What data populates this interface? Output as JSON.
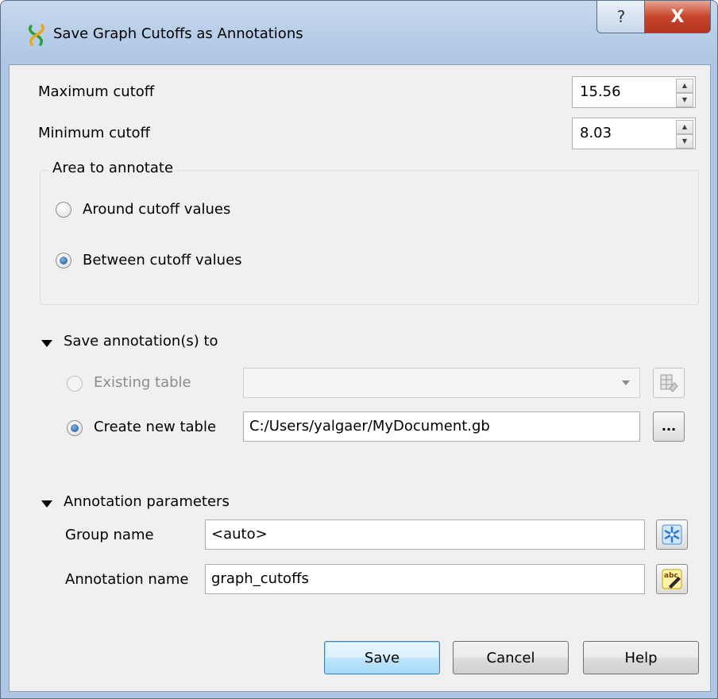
{
  "window": {
    "title": "Save Graph Cutoffs as Annotations",
    "help_glyph": "?",
    "close_glyph": "X"
  },
  "cutoffs": {
    "max_label": "Maximum cutoff",
    "max_value": "15.56",
    "min_label": "Minimum cutoff",
    "min_value": "8.03"
  },
  "area_group": {
    "title": "Area to annotate",
    "options": [
      {
        "label": "Around cutoff values",
        "checked": false
      },
      {
        "label": "Between cutoff values",
        "checked": true
      }
    ]
  },
  "save_section": {
    "title": "Save annotation(s) to",
    "existing_label": "Existing table",
    "existing_value": "",
    "create_label": "Create new table",
    "create_value": "C:/Users/yalgaer/MyDocument.gb",
    "browse_label": "..."
  },
  "params_section": {
    "title": "Annotation parameters",
    "group_label": "Group name",
    "group_value": "<auto>",
    "annotation_label": "Annotation name",
    "annotation_value": "graph_cutoffs",
    "abc_glyph": "abc"
  },
  "buttons": {
    "save": "Save",
    "cancel": "Cancel",
    "help": "Help"
  },
  "colors": {
    "accent": "#3c7fb1",
    "close": "#c7452c",
    "window_frame": "#b9cfe8"
  }
}
